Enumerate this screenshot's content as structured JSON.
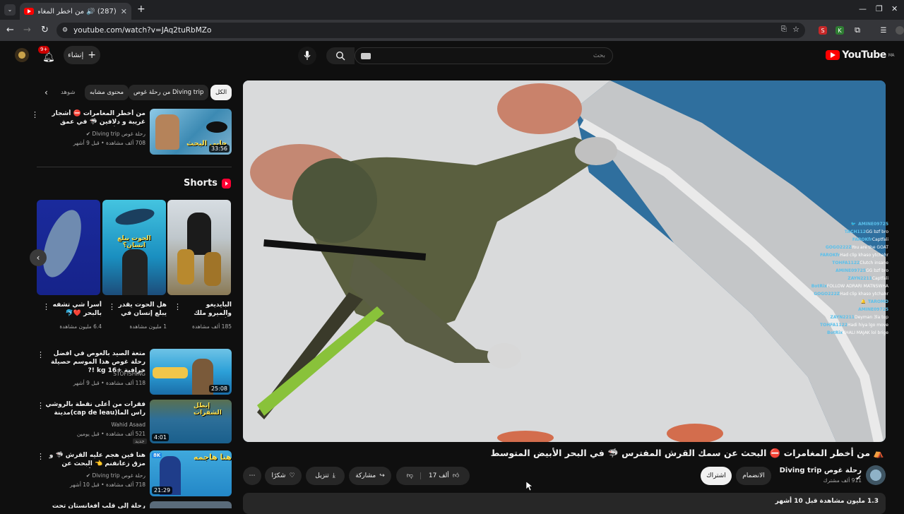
{
  "browser": {
    "tab_title": "(287) 🔊 من أخطر المغامرات",
    "url": "youtube.com/watch?v=JAq2tuRbMZo"
  },
  "masthead": {
    "notifications_count": "9+",
    "create_label": "إنشاء",
    "search_placeholder": "بحث",
    "logo_text": "YouTube",
    "logo_sup": "MA"
  },
  "chips": {
    "all": "الكل",
    "diving": "من رحلة غوص Diving trip",
    "similar": "محتوى مشابه",
    "watched": "شوهد"
  },
  "related_top": {
    "title": "من أخطر المغامرات ⛔ أشجار غريبة و دلافين 🦈 في عمق المحيط الأطلسي ⛺ ...",
    "channel": "رحلة غوص Diving trip",
    "meta": "708 ألف مشاهدة • قبل 9 أشهر",
    "duration": "33:56",
    "thumb_caption": "جابي البحث"
  },
  "shorts": {
    "heading": "Shorts",
    "items": [
      {
        "title": "البايديغو والميرو ملك الأعماق",
        "views": "185 ألف مشاهدة"
      },
      {
        "title": "هل الحوت يقدر يبلع إنسان في ...",
        "views": "1 مليون مشاهدة",
        "thumb_caption": "الحوت يبلع انسان؟"
      },
      {
        "title": "أسرأ شي تشفه بالبحر ❤️🐬",
        "views": "6.4 مليون مشاهدة"
      }
    ]
  },
  "related": [
    {
      "title": "متعة الصيد بالغوص في افضل رحلة غوص هذا الموسم حصيلة خرافية +16 kg !?",
      "channel": "STOFISHING",
      "meta": "118 ألف مشاهدة • قبل 9 أشهر",
      "duration": "25:08"
    },
    {
      "title": "فقرات من أعلى نقطة بالروشي راس الما(cap de leau)مدينة الحين",
      "channel": "Wahid Asaad",
      "meta": "521 ألف مشاهدة • قبل يومين",
      "badge": "جديد",
      "duration": "4:01",
      "thumb_caption": "إبطل الشفرات"
    },
    {
      "title": "هنا فين هجم عليه القرش 🦈 و مزق زعانفنم 👈 البحث عن القرش النمر في أ...",
      "channel": "رحلة غوص Diving trip",
      "meta": "718 ألف مشاهدة • قبل 10 أشهر",
      "duration": "21:29",
      "quality": "8K",
      "thumb_caption": "هنا هاجمه"
    },
    {
      "title": "رحلة إلى قلب أفغانستان تحت سيطرة طالب...",
      "channel": "",
      "meta": ""
    }
  ],
  "chat": [
    {
      "user": "AMINE09725",
      "msg": "🐦"
    },
    {
      "user": "TACH112",
      "msg": "GG bzf bro"
    },
    {
      "user": "FAROKfr",
      "msg": "Captfali"
    },
    {
      "user": "GOGO222Z",
      "msg": "You are the GOAT"
    },
    {
      "user": "FAROKfr",
      "msg": "Had clip khaso ytchahr"
    },
    {
      "user": "TOHFA1122",
      "msg": "Clutch insane"
    },
    {
      "user": "AMINE09725",
      "msg": "GG bzf bro"
    },
    {
      "user": "ZAYN2211",
      "msg": "Captfali"
    },
    {
      "user": "BotRix",
      "msg": "FOLLOW ADRARI MATNSWHA"
    },
    {
      "user": "GOGO222Z",
      "msg": "Had clip khaso ytchahr"
    },
    {
      "user": "TAROMO",
      "msg": "🔔"
    },
    {
      "user": "AMINE09725",
      "msg": ""
    },
    {
      "user": "ZAYN2211",
      "msg": "Deyman 3la top"
    },
    {
      "user": "TOHFA1122",
      "msg": "Hadi hiya lgo move"
    },
    {
      "user": "BotRix",
      "msg": "KHALI MAJAK lol brige"
    }
  ],
  "video": {
    "title": "⛺ من أخطر المغامرات ⛔ البحث عن سمك القرش المفترس 🦈 في البحر الأبيض المتوسط",
    "channel": "رحلة غوص Diving trip",
    "subscribers": "911 ألف مشترك",
    "join_label": "الانضمام",
    "subscribe_label": "اشتراك",
    "likes": "17 ألف",
    "share_label": "مشاركة",
    "download_label": "تنزيل",
    "thanks_label": "شكرًا",
    "views_meta": "1.3 مليون مشاهدة  قبل 10 أشهر"
  },
  "colors": {
    "bg": "#0f0f0f",
    "surface": "#272727",
    "brand_red": "#ff0000"
  }
}
